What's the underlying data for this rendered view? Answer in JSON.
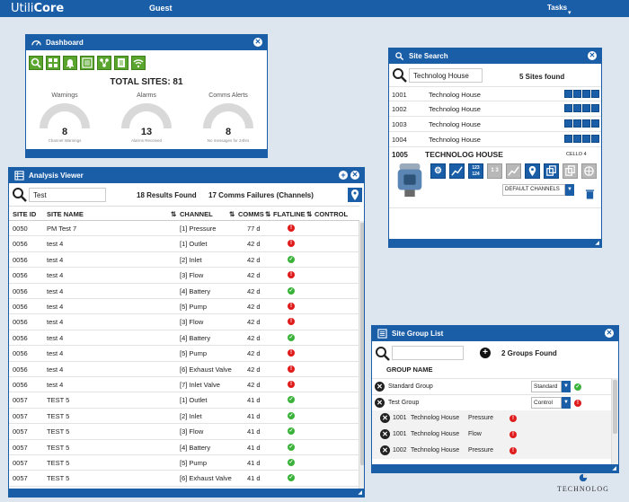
{
  "topbar": {
    "logo_a": "Utili",
    "logo_b": "Core",
    "user": "Guest",
    "tasks": "Tasks",
    "tasks_caret": "▾"
  },
  "dashboard": {
    "title": "Dashboard",
    "total": "TOTAL SITES: 81",
    "gauges": [
      {
        "label": "Warnings",
        "value": "8",
        "sub": "Channel Warnings"
      },
      {
        "label": "Alarms",
        "value": "13",
        "sub": "Alarms Received"
      },
      {
        "label": "Comms Alerts",
        "value": "8",
        "sub": "No messages for 24hrs"
      }
    ]
  },
  "analysis": {
    "title": "Analysis Viewer",
    "search_value": "Test",
    "results": "18 Results Found",
    "comms": "17 Comms Failures (Channels)",
    "columns": {
      "site_id": "SITE ID",
      "site_name": "SITE NAME",
      "channel": "CHANNEL",
      "comms": "COMMS",
      "flatline": "FLATLINE",
      "control": "CONTROL"
    },
    "rows": [
      {
        "id": "0050",
        "name": "PM Test 7",
        "channel": "[1] Pressure",
        "comms": "77 d",
        "status": "red"
      },
      {
        "id": "0056",
        "name": "test 4",
        "channel": "[1] Outlet",
        "comms": "42 d",
        "status": "red"
      },
      {
        "id": "0056",
        "name": "test 4",
        "channel": "[2] Inlet",
        "comms": "42 d",
        "status": "green"
      },
      {
        "id": "0056",
        "name": "test 4",
        "channel": "[3] Flow",
        "comms": "42 d",
        "status": "red"
      },
      {
        "id": "0056",
        "name": "test 4",
        "channel": "[4] Battery",
        "comms": "42 d",
        "status": "green"
      },
      {
        "id": "0056",
        "name": "test 4",
        "channel": "[5] Pump",
        "comms": "42 d",
        "status": "red"
      },
      {
        "id": "0056",
        "name": "test 4",
        "channel": "[3] Flow",
        "comms": "42 d",
        "status": "red"
      },
      {
        "id": "0056",
        "name": "test 4",
        "channel": "[4] Battery",
        "comms": "42 d",
        "status": "green"
      },
      {
        "id": "0056",
        "name": "test 4",
        "channel": "[5] Pump",
        "comms": "42 d",
        "status": "red"
      },
      {
        "id": "0056",
        "name": "test 4",
        "channel": "[6] Exhaust Valve",
        "comms": "42 d",
        "status": "red"
      },
      {
        "id": "0056",
        "name": "test 4",
        "channel": "[7] Inlet Valve",
        "comms": "42 d",
        "status": "red"
      },
      {
        "id": "0057",
        "name": "TEST 5",
        "channel": "[1] Outlet",
        "comms": "41 d",
        "status": "green"
      },
      {
        "id": "0057",
        "name": "TEST 5",
        "channel": "[2] Inlet",
        "comms": "41 d",
        "status": "green"
      },
      {
        "id": "0057",
        "name": "TEST 5",
        "channel": "[3] Flow",
        "comms": "41 d",
        "status": "green"
      },
      {
        "id": "0057",
        "name": "TEST 5",
        "channel": "[4] Battery",
        "comms": "41 d",
        "status": "green"
      },
      {
        "id": "0057",
        "name": "TEST 5",
        "channel": "[5] Pump",
        "comms": "41 d",
        "status": "green"
      },
      {
        "id": "0057",
        "name": "TEST 5",
        "channel": "[6] Exhaust Valve",
        "comms": "41 d",
        "status": "green"
      }
    ]
  },
  "site_search": {
    "title": "Site Search",
    "search_value": "Technolog House",
    "found": "5 Sites found",
    "rows": [
      {
        "id": "1001",
        "name": "Technolog House"
      },
      {
        "id": "1002",
        "name": "Technolog House"
      },
      {
        "id": "1003",
        "name": "Technolog House"
      },
      {
        "id": "1004",
        "name": "Technolog House"
      }
    ],
    "selected": {
      "id": "1005",
      "name": "TECHNOLOG HOUSE",
      "model": "CELLO 4"
    },
    "channels_select": "DEFAULT CHANNELS",
    "btn_numbers": "123 124",
    "btn_small": "1 3"
  },
  "group_list": {
    "title": "Site Group List",
    "found": "2 Groups Found",
    "header": "GROUP NAME",
    "groups": [
      {
        "name": "Standard Group",
        "type": "Standard",
        "status": "green"
      },
      {
        "name": "Test Group",
        "type": "Control",
        "status": "red"
      }
    ],
    "members": [
      {
        "id": "1001",
        "name": "Technolog House",
        "channel": "Pressure"
      },
      {
        "id": "1001",
        "name": "Technolog House",
        "channel": "Flow"
      },
      {
        "id": "1002",
        "name": "Technolog House",
        "channel": "Pressure"
      }
    ]
  },
  "brand": "TECHNOLOG",
  "colors": {
    "primary": "#1a5ea8",
    "toolbar_green": "#5aa52d",
    "alarm_red": "#e01b1b",
    "ok_green": "#3bb33b",
    "background": "#dde6ef"
  }
}
